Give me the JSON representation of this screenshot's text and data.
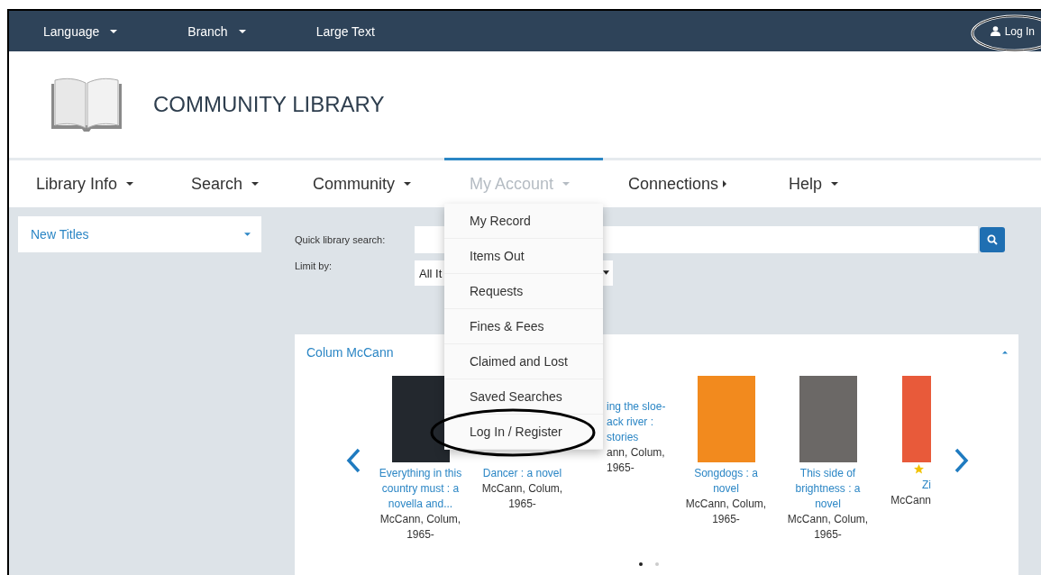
{
  "top_bar": {
    "items": [
      {
        "label": "Language",
        "caret": true
      },
      {
        "label": "Branch",
        "caret": true
      },
      {
        "label": "Large Text",
        "caret": false
      }
    ],
    "login": {
      "label": "Log In",
      "highlighted": true
    }
  },
  "header": {
    "title": "COMMUNITY LIBRARY"
  },
  "nav": [
    {
      "label": "Library Info",
      "kind": "dropdown",
      "selected": false
    },
    {
      "label": "Search",
      "kind": "dropdown",
      "selected": false
    },
    {
      "label": "Community",
      "kind": "dropdown",
      "selected": false
    },
    {
      "label": "My Account",
      "kind": "dropdown",
      "selected": true
    },
    {
      "label": "Connections",
      "kind": "flyout",
      "selected": false
    },
    {
      "label": "Help",
      "kind": "dropdown",
      "selected": false
    }
  ],
  "account_menu": [
    {
      "label": "My Record",
      "highlighted": false
    },
    {
      "label": "Items Out",
      "highlighted": false
    },
    {
      "label": "Requests",
      "highlighted": false
    },
    {
      "label": "Fines & Fees",
      "highlighted": false
    },
    {
      "label": "Claimed and Lost",
      "highlighted": false
    },
    {
      "label": "Saved Searches",
      "highlighted": false
    },
    {
      "label": "Log In / Register",
      "highlighted": true
    }
  ],
  "sidebar": {
    "dropdown": "New Titles"
  },
  "search": {
    "label": "Quick library search:",
    "limit_label": "Limit by:",
    "limit_value": "All It"
  },
  "carousel": {
    "title": "Colum McCann",
    "books": [
      {
        "kind": "full",
        "color": "#23282e",
        "title": [
          "Everything in this",
          "country must : a",
          "novella and..."
        ],
        "author": [
          "McCann, Colum,",
          "1965-"
        ]
      },
      {
        "kind": "full",
        "title": [
          "Dancer : a novel"
        ],
        "author": [
          "McCann, Colum,",
          "1965-"
        ]
      },
      {
        "kind": "partial",
        "title": [
          "ing the sloe-",
          "ack river :",
          "stories"
        ],
        "author": [
          "ann, Colum,",
          "1965-"
        ]
      },
      {
        "kind": "full",
        "color": "#f28a1e",
        "title": [
          "Songdogs : a",
          "novel"
        ],
        "author": [
          "McCann, Colum,",
          "1965-"
        ]
      },
      {
        "kind": "full",
        "color": "#6b6866",
        "title": [
          "This side of",
          "brightness : a",
          "novel"
        ],
        "author": [
          "McCann, Colum,",
          "1965-"
        ]
      },
      {
        "kind": "cut",
        "color": "#e85a3a",
        "starred": true,
        "title": [
          "Zi"
        ],
        "author": [
          "McCann"
        ]
      }
    ],
    "dots": [
      {
        "selected": true
      },
      {
        "selected": false
      }
    ]
  }
}
